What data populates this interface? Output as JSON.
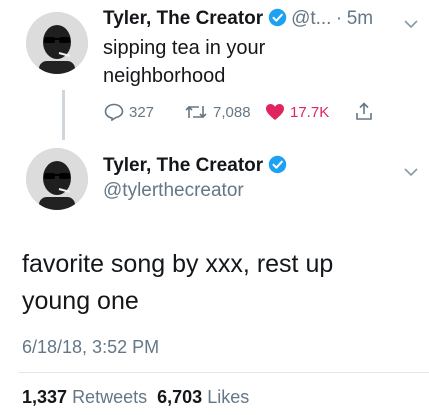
{
  "tweet1": {
    "name": "Tyler, The Creator",
    "handle": "@t...",
    "separator": "·",
    "time": "5m",
    "text_line1": "sipping tea in your",
    "text_line2": "neighborhood",
    "replies": "327",
    "retweets": "7,088",
    "likes": "17.7K"
  },
  "tweet2": {
    "name": "Tyler, The Creator",
    "handle": "@tylerthecreator",
    "text_line1": "favorite song by xxx, rest up",
    "text_line2": "young one",
    "timestamp": "6/18/18, 3:52 PM",
    "retweet_count": "1,337",
    "retweet_label": "Retweets",
    "like_count": "6,703",
    "like_label": "Likes"
  },
  "colors": {
    "verified": "#1da1f2",
    "like_red": "#e0245e",
    "secondary": "#657786"
  },
  "icons": [
    "verified-badge-icon",
    "chevron-down-icon",
    "reply-icon",
    "retweet-icon",
    "heart-icon",
    "share-icon"
  ]
}
